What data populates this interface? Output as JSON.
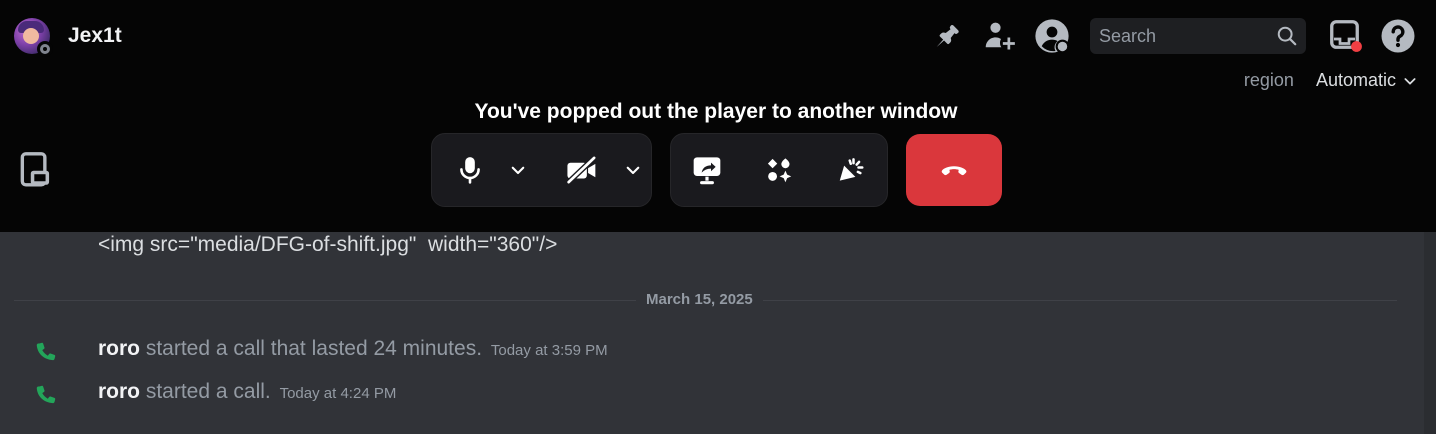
{
  "header": {
    "username": "Jex1t",
    "search_placeholder": "Search",
    "icons": [
      "pin-icon",
      "add-member-icon",
      "profile-icon",
      "search-icon",
      "inbox-icon",
      "help-icon"
    ]
  },
  "region": {
    "label": "region",
    "value": "Automatic"
  },
  "call": {
    "popout_message": "You've popped out the player to another window",
    "controls": [
      "microphone-icon",
      "mic-options-chevron",
      "camera-off-icon",
      "camera-options-chevron",
      "screen-share-icon",
      "activities-icon",
      "soundboard-icon",
      "hang-up-icon"
    ]
  },
  "messages": {
    "image_markup": "<img src=\"media/DFG-of-shift.jpg\"  width=\"360\"/>",
    "date_divider": "March 15, 2025",
    "calls": [
      {
        "user": "roro",
        "text": "started a call that lasted 24 minutes.",
        "time": "Today at 3:59 PM"
      },
      {
        "user": "roro",
        "text": "started a call.",
        "time": "Today at 4:24 PM"
      }
    ]
  },
  "colors": {
    "hangup": "#da373c",
    "phone_green": "#23a55a",
    "unread_red": "#f23f43",
    "background": "#313338",
    "call_bg": "#050505"
  }
}
